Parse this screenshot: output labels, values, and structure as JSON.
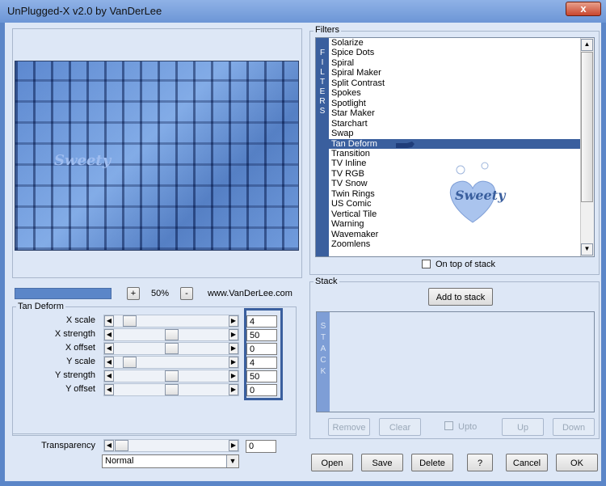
{
  "window": {
    "title": "UnPlugged-X v2.0 by VanDerLee",
    "close_glyph": "x"
  },
  "zoom": {
    "plus": "+",
    "value": "50%",
    "minus": "-",
    "website": "www.VanDerLee.com"
  },
  "filters": {
    "group_label": "Filters",
    "side_label": [
      "F",
      "I",
      "L",
      "T",
      "E",
      "R",
      "S"
    ],
    "items": [
      "Solarize",
      "Spice Dots",
      "Spiral",
      "Spiral Maker",
      "Split Contrast",
      "Spokes",
      "Spotlight",
      "Star Maker",
      "Starchart",
      "Swap",
      "Tan Deform",
      "Transition",
      "TV Inline",
      "TV RGB",
      "TV Snow",
      "Twin Rings",
      "US Comic",
      "Vertical Tile",
      "Warning",
      "Wavemaker",
      "Zoomlens"
    ],
    "selected": "Tan Deform",
    "on_top_label": "On top of stack"
  },
  "params": {
    "group_label": "Tan Deform",
    "rows": [
      {
        "label": "X scale",
        "value": "4",
        "level": 0.08
      },
      {
        "label": "X strength",
        "value": "50",
        "level": 0.5
      },
      {
        "label": "X offset",
        "value": "0",
        "level": 0.5
      },
      {
        "label": "Y scale",
        "value": "4",
        "level": 0.08
      },
      {
        "label": "Y strength",
        "value": "50",
        "level": 0.5
      },
      {
        "label": "Y offset",
        "value": "0",
        "level": 0.5
      }
    ]
  },
  "transparency": {
    "label": "Transparency",
    "value": "0",
    "level": 0.0,
    "blend_mode": "Normal"
  },
  "stack": {
    "group_label": "Stack",
    "add_label": "Add to stack",
    "side_label": [
      "S",
      "T",
      "A",
      "C",
      "K"
    ],
    "remove_label": "Remove",
    "clear_label": "Clear",
    "upto_label": "Upto",
    "up_label": "Up",
    "down_label": "Down"
  },
  "buttons": {
    "open": "Open",
    "save": "Save",
    "delete": "Delete",
    "help": "?",
    "cancel": "Cancel",
    "ok": "OK"
  },
  "watermark": "Sweety",
  "colors": {
    "accent": "#3a5f9e",
    "selection": "#3a5f9e",
    "client": "#dde7f6"
  }
}
